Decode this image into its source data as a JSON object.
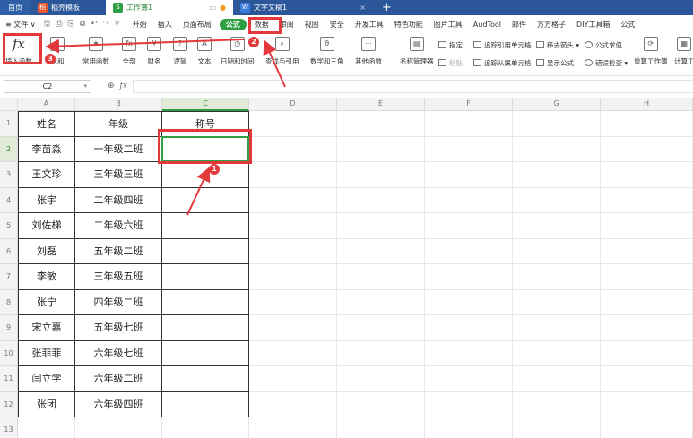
{
  "tabs": {
    "home": "首页",
    "template": "稻壳模板",
    "workbook": "工作簿1",
    "document": "文字文稿1",
    "new_tab": "+"
  },
  "menu": {
    "file": "≡ 文件 ∨",
    "items": [
      "开始",
      "插入",
      "页面布局",
      "公式",
      "数据",
      "审阅",
      "视图",
      "安全",
      "开发工具",
      "特色功能",
      "图片工具",
      "AudTool",
      "邮件",
      "方方格子",
      "DIY工具箱",
      "公式"
    ],
    "active": "公式"
  },
  "ribbon": {
    "insert_function": "插入函数",
    "autosum": "求和",
    "common_functions": "常用函数",
    "all": "全部",
    "finance": "财务",
    "logic": "逻辑",
    "text": "文本",
    "datetime": "日期和时间",
    "lookup": "查找与引用",
    "math": "数学和三角",
    "other_functions": "其他函数",
    "name_manager": "名称管理器",
    "specify": "指定",
    "paste": "粘贴",
    "trace_precedents": "追踪引用单元格",
    "trace_dependents": "追踪从属单元格",
    "remove_arrows": "移去箭头",
    "show_formulas": "显示公式",
    "evaluate": "公式求值",
    "error_check": "错误检查",
    "recalc_workbook": "重算工作簿",
    "calculate": "计算工"
  },
  "formula_bar": {
    "cell_ref": "C2",
    "fx": "fx",
    "value": ""
  },
  "columns": [
    "A",
    "B",
    "C",
    "D",
    "E",
    "F",
    "G",
    "H"
  ],
  "selected_column": "C",
  "rows": [
    {
      "n": "1",
      "name": "姓名",
      "grade": "年级",
      "title": "称号"
    },
    {
      "n": "2",
      "name": "李苗淼",
      "grade": "一年级二班",
      "title": ""
    },
    {
      "n": "3",
      "name": "王文珍",
      "grade": "三年级三班",
      "title": ""
    },
    {
      "n": "4",
      "name": "张宇",
      "grade": "二年级四班",
      "title": ""
    },
    {
      "n": "5",
      "name": "刘佐梯",
      "grade": "二年级六班",
      "title": ""
    },
    {
      "n": "6",
      "name": "刘磊",
      "grade": "五年级二班",
      "title": ""
    },
    {
      "n": "7",
      "name": "李敏",
      "grade": "三年级五班",
      "title": ""
    },
    {
      "n": "8",
      "name": "张宁",
      "grade": "四年级二班",
      "title": ""
    },
    {
      "n": "9",
      "name": "宋立嘉",
      "grade": "五年级七班",
      "title": ""
    },
    {
      "n": "10",
      "name": "张菲菲",
      "grade": "六年级七班",
      "title": ""
    },
    {
      "n": "11",
      "name": "闫立学",
      "grade": "六年级二班",
      "title": ""
    },
    {
      "n": "12",
      "name": "张团",
      "grade": "六年级四班",
      "title": ""
    },
    {
      "n": "13",
      "name": "",
      "grade": "",
      "title": ""
    }
  ],
  "annotations": {
    "step1": "1",
    "step2": "2",
    "step3": "3"
  },
  "colors": {
    "accent_green": "#2ea043",
    "annotation_red": "#e3393c",
    "tabbar_blue": "#2b579a"
  }
}
